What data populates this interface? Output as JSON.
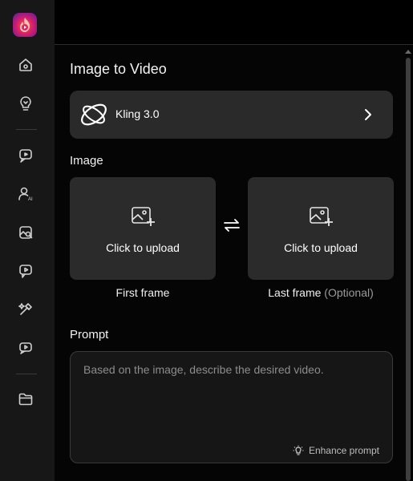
{
  "sidebar": {
    "items": [
      {
        "icon": "home-icon"
      },
      {
        "icon": "lightbulb-icon"
      },
      {
        "icon": "video-chat-icon"
      },
      {
        "icon": "ai-avatar-icon"
      },
      {
        "icon": "image-search-icon"
      },
      {
        "icon": "video-play-icon"
      },
      {
        "icon": "magic-brush-icon"
      },
      {
        "icon": "video-history-icon"
      },
      {
        "icon": "folder-icon"
      }
    ]
  },
  "panel": {
    "title": "Image to Video",
    "model": {
      "name": "Kling 3.0"
    },
    "image_section_label": "Image",
    "first_frame": {
      "upload_text": "Click to upload",
      "caption": "First frame"
    },
    "last_frame": {
      "upload_text": "Click to upload",
      "caption": "Last frame",
      "optional_note": "(Optional)"
    },
    "prompt_label": "Prompt",
    "prompt_placeholder": "Based on the image, describe the desired video.",
    "prompt_value": "",
    "enhance_label": "Enhance prompt"
  },
  "colors": {
    "background": "#000000",
    "sidebar": "#171717",
    "card": "#2b2b2b",
    "accent_logo": "#ff5a3c"
  }
}
